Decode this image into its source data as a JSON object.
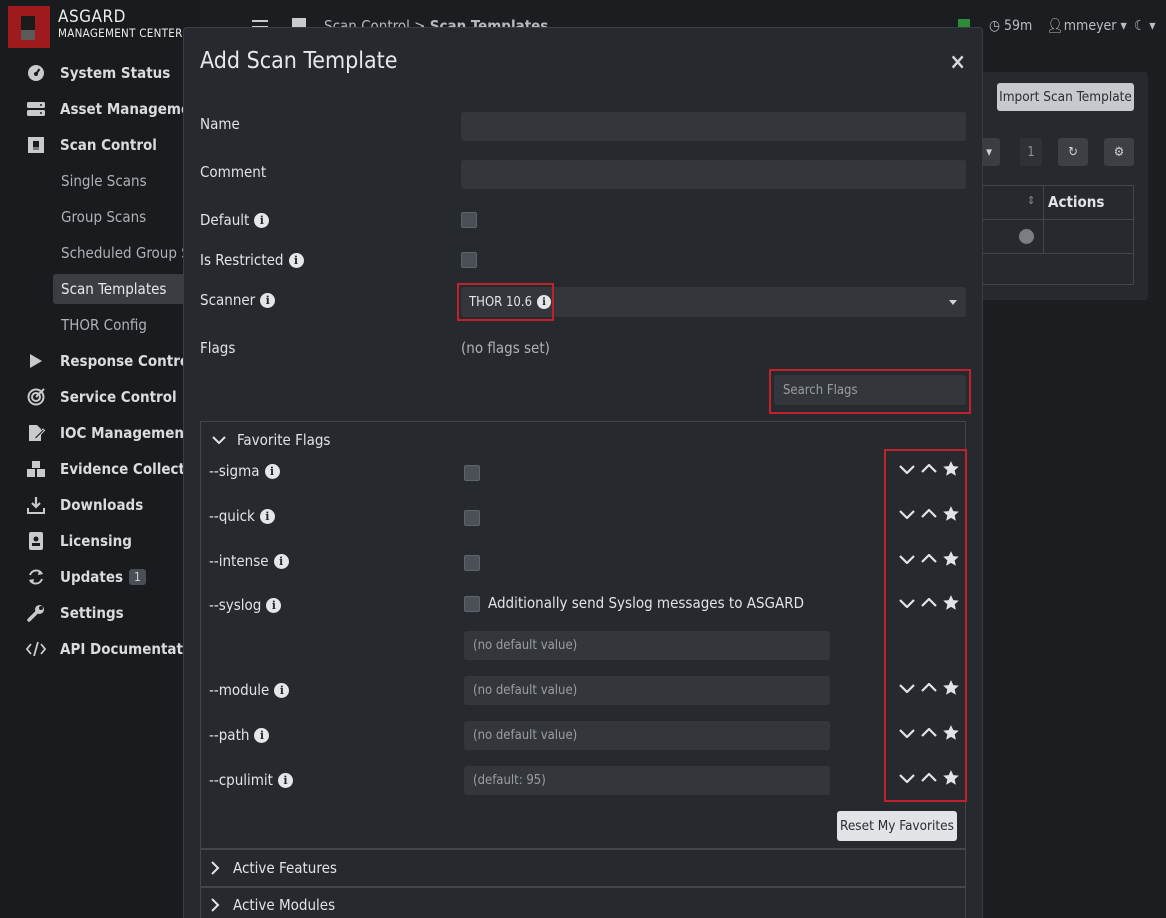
{
  "app": {
    "name_line1": "ASGARD",
    "name_line2": "MANAGEMENT CENTER"
  },
  "topbar": {
    "breadcrumb_parent": "Scan Control",
    "breadcrumb_sep": ">",
    "breadcrumb_current": "Scan Templates",
    "session_time": "59m",
    "user": "mmeyer"
  },
  "sidebar": {
    "items": [
      {
        "label": "System Status",
        "icon": "dashboard-icon"
      },
      {
        "label": "Asset Management",
        "icon": "server-icon"
      },
      {
        "label": "Scan Control",
        "icon": "scan-icon"
      },
      {
        "label": "Response Control",
        "icon": "play-icon"
      },
      {
        "label": "Service Control",
        "icon": "target-icon"
      },
      {
        "label": "IOC Management",
        "icon": "file-edit-icon"
      },
      {
        "label": "Evidence Collection",
        "icon": "boxes-icon"
      },
      {
        "label": "Downloads",
        "icon": "download-icon"
      },
      {
        "label": "Licensing",
        "icon": "id-badge-icon"
      },
      {
        "label": "Updates",
        "icon": "sync-icon",
        "badge": "1"
      },
      {
        "label": "Settings",
        "icon": "wrench-icon"
      },
      {
        "label": "API Documentation",
        "icon": "code-icon"
      }
    ],
    "sub_items": [
      "Single Scans",
      "Group Scans",
      "Scheduled Group Scans",
      "Scan Templates",
      "THOR Config"
    ]
  },
  "background": {
    "import_button": "Import Scan Template",
    "page_number": "1",
    "actions_header": "Actions"
  },
  "modal": {
    "title": "Add Scan Template",
    "close": "×",
    "name_label": "Name",
    "comment_label": "Comment",
    "default_label": "Default",
    "restricted_label": "Is Restricted",
    "scanner_label": "Scanner",
    "scanner_value": "THOR 10.6",
    "flags_label": "Flags",
    "flags_value": "(no flags set)",
    "search_placeholder": "Search Flags",
    "favorites_header": "Favorite Flags",
    "flags": [
      {
        "name": "--sigma",
        "type": "checkbox"
      },
      {
        "name": "--quick",
        "type": "checkbox"
      },
      {
        "name": "--intense",
        "type": "checkbox"
      },
      {
        "name": "--syslog",
        "type": "checkbox",
        "checkbox_label": "Additionally send Syslog messages to ASGARD",
        "placeholder": "(no default value)"
      },
      {
        "name": "--module",
        "type": "text",
        "placeholder": "(no default value)"
      },
      {
        "name": "--path",
        "type": "text",
        "placeholder": "(no default value)"
      },
      {
        "name": "--cpulimit",
        "type": "text",
        "placeholder": "(default: 95)"
      }
    ],
    "reset_favorites": "Reset My Favorites",
    "active_features": "Active Features",
    "active_modules": "Active Modules"
  },
  "colors": {
    "accent_red": "#c0212b",
    "modal_bg": "#26292d",
    "input_bg": "#33373c"
  }
}
